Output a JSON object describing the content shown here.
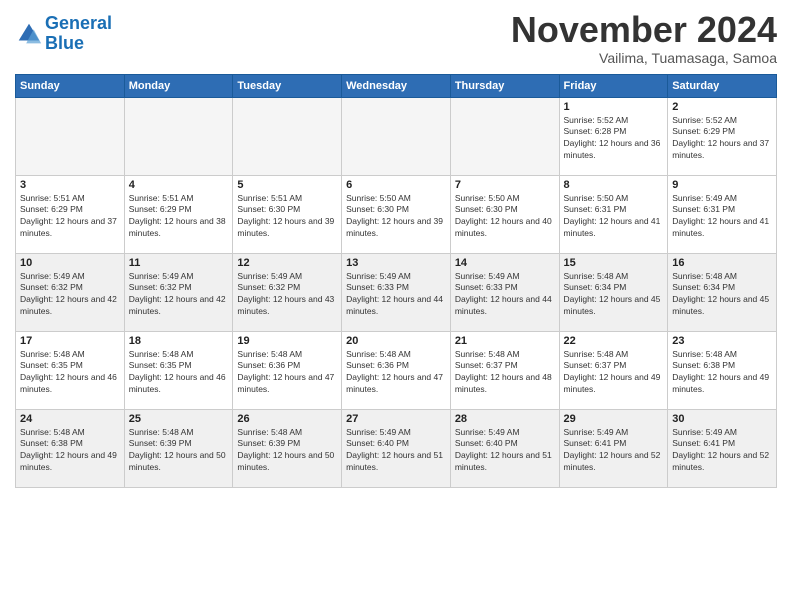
{
  "header": {
    "logo_line1": "General",
    "logo_line2": "Blue",
    "month": "November 2024",
    "location": "Vailima, Tuamasaga, Samoa"
  },
  "days_of_week": [
    "Sunday",
    "Monday",
    "Tuesday",
    "Wednesday",
    "Thursday",
    "Friday",
    "Saturday"
  ],
  "weeks": [
    [
      {
        "day": "",
        "info": "",
        "empty": true
      },
      {
        "day": "",
        "info": "",
        "empty": true
      },
      {
        "day": "",
        "info": "",
        "empty": true
      },
      {
        "day": "",
        "info": "",
        "empty": true
      },
      {
        "day": "",
        "info": "",
        "empty": true
      },
      {
        "day": "1",
        "info": "Sunrise: 5:52 AM\nSunset: 6:28 PM\nDaylight: 12 hours and 36 minutes.",
        "empty": false
      },
      {
        "day": "2",
        "info": "Sunrise: 5:52 AM\nSunset: 6:29 PM\nDaylight: 12 hours and 37 minutes.",
        "empty": false
      }
    ],
    [
      {
        "day": "3",
        "info": "Sunrise: 5:51 AM\nSunset: 6:29 PM\nDaylight: 12 hours and 37 minutes.",
        "empty": false
      },
      {
        "day": "4",
        "info": "Sunrise: 5:51 AM\nSunset: 6:29 PM\nDaylight: 12 hours and 38 minutes.",
        "empty": false
      },
      {
        "day": "5",
        "info": "Sunrise: 5:51 AM\nSunset: 6:30 PM\nDaylight: 12 hours and 39 minutes.",
        "empty": false
      },
      {
        "day": "6",
        "info": "Sunrise: 5:50 AM\nSunset: 6:30 PM\nDaylight: 12 hours and 39 minutes.",
        "empty": false
      },
      {
        "day": "7",
        "info": "Sunrise: 5:50 AM\nSunset: 6:30 PM\nDaylight: 12 hours and 40 minutes.",
        "empty": false
      },
      {
        "day": "8",
        "info": "Sunrise: 5:50 AM\nSunset: 6:31 PM\nDaylight: 12 hours and 41 minutes.",
        "empty": false
      },
      {
        "day": "9",
        "info": "Sunrise: 5:49 AM\nSunset: 6:31 PM\nDaylight: 12 hours and 41 minutes.",
        "empty": false
      }
    ],
    [
      {
        "day": "10",
        "info": "Sunrise: 5:49 AM\nSunset: 6:32 PM\nDaylight: 12 hours and 42 minutes.",
        "empty": false
      },
      {
        "day": "11",
        "info": "Sunrise: 5:49 AM\nSunset: 6:32 PM\nDaylight: 12 hours and 42 minutes.",
        "empty": false
      },
      {
        "day": "12",
        "info": "Sunrise: 5:49 AM\nSunset: 6:32 PM\nDaylight: 12 hours and 43 minutes.",
        "empty": false
      },
      {
        "day": "13",
        "info": "Sunrise: 5:49 AM\nSunset: 6:33 PM\nDaylight: 12 hours and 44 minutes.",
        "empty": false
      },
      {
        "day": "14",
        "info": "Sunrise: 5:49 AM\nSunset: 6:33 PM\nDaylight: 12 hours and 44 minutes.",
        "empty": false
      },
      {
        "day": "15",
        "info": "Sunrise: 5:48 AM\nSunset: 6:34 PM\nDaylight: 12 hours and 45 minutes.",
        "empty": false
      },
      {
        "day": "16",
        "info": "Sunrise: 5:48 AM\nSunset: 6:34 PM\nDaylight: 12 hours and 45 minutes.",
        "empty": false
      }
    ],
    [
      {
        "day": "17",
        "info": "Sunrise: 5:48 AM\nSunset: 6:35 PM\nDaylight: 12 hours and 46 minutes.",
        "empty": false
      },
      {
        "day": "18",
        "info": "Sunrise: 5:48 AM\nSunset: 6:35 PM\nDaylight: 12 hours and 46 minutes.",
        "empty": false
      },
      {
        "day": "19",
        "info": "Sunrise: 5:48 AM\nSunset: 6:36 PM\nDaylight: 12 hours and 47 minutes.",
        "empty": false
      },
      {
        "day": "20",
        "info": "Sunrise: 5:48 AM\nSunset: 6:36 PM\nDaylight: 12 hours and 47 minutes.",
        "empty": false
      },
      {
        "day": "21",
        "info": "Sunrise: 5:48 AM\nSunset: 6:37 PM\nDaylight: 12 hours and 48 minutes.",
        "empty": false
      },
      {
        "day": "22",
        "info": "Sunrise: 5:48 AM\nSunset: 6:37 PM\nDaylight: 12 hours and 49 minutes.",
        "empty": false
      },
      {
        "day": "23",
        "info": "Sunrise: 5:48 AM\nSunset: 6:38 PM\nDaylight: 12 hours and 49 minutes.",
        "empty": false
      }
    ],
    [
      {
        "day": "24",
        "info": "Sunrise: 5:48 AM\nSunset: 6:38 PM\nDaylight: 12 hours and 49 minutes.",
        "empty": false
      },
      {
        "day": "25",
        "info": "Sunrise: 5:48 AM\nSunset: 6:39 PM\nDaylight: 12 hours and 50 minutes.",
        "empty": false
      },
      {
        "day": "26",
        "info": "Sunrise: 5:48 AM\nSunset: 6:39 PM\nDaylight: 12 hours and 50 minutes.",
        "empty": false
      },
      {
        "day": "27",
        "info": "Sunrise: 5:49 AM\nSunset: 6:40 PM\nDaylight: 12 hours and 51 minutes.",
        "empty": false
      },
      {
        "day": "28",
        "info": "Sunrise: 5:49 AM\nSunset: 6:40 PM\nDaylight: 12 hours and 51 minutes.",
        "empty": false
      },
      {
        "day": "29",
        "info": "Sunrise: 5:49 AM\nSunset: 6:41 PM\nDaylight: 12 hours and 52 minutes.",
        "empty": false
      },
      {
        "day": "30",
        "info": "Sunrise: 5:49 AM\nSunset: 6:41 PM\nDaylight: 12 hours and 52 minutes.",
        "empty": false
      }
    ]
  ]
}
